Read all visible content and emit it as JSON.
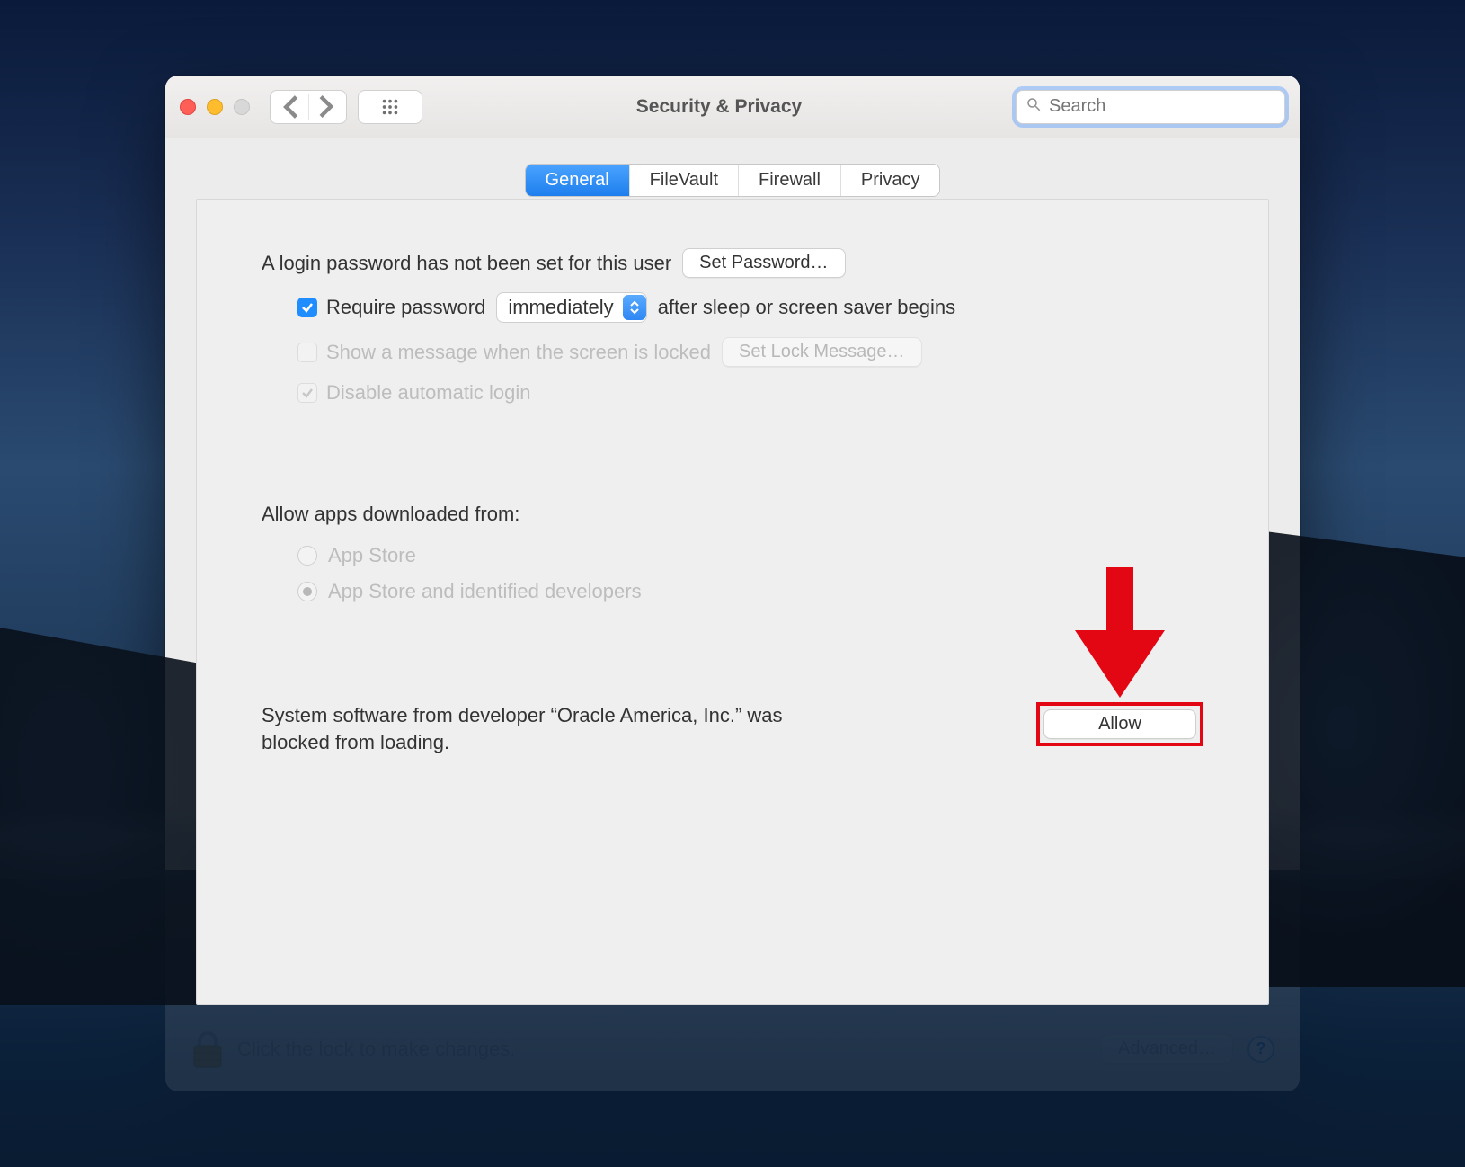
{
  "window": {
    "title": "Security & Privacy"
  },
  "search": {
    "placeholder": "Search",
    "value": ""
  },
  "tabs": [
    {
      "label": "General",
      "active": true
    },
    {
      "label": "FileVault",
      "active": false
    },
    {
      "label": "Firewall",
      "active": false
    },
    {
      "label": "Privacy",
      "active": false
    }
  ],
  "general": {
    "login_password_not_set": "A login password has not been set for this user",
    "set_password_button": "Set Password…",
    "require_password_label": "Require password",
    "require_password_delay_selected": "immediately",
    "require_password_suffix": "after sleep or screen saver begins",
    "show_message_label": "Show a message when the screen is locked",
    "set_lock_message_button": "Set Lock Message…",
    "disable_auto_login_label": "Disable automatic login",
    "allow_apps_heading": "Allow apps downloaded from:",
    "allow_apps_options": [
      {
        "label": "App Store",
        "selected": false
      },
      {
        "label": "App Store and identified developers",
        "selected": true
      }
    ],
    "blocked_message": "System software from developer “Oracle America, Inc.” was blocked from loading.",
    "allow_button": "Allow"
  },
  "footer": {
    "lock_text": "Click the lock to make changes.",
    "advanced_button": "Advanced…"
  }
}
